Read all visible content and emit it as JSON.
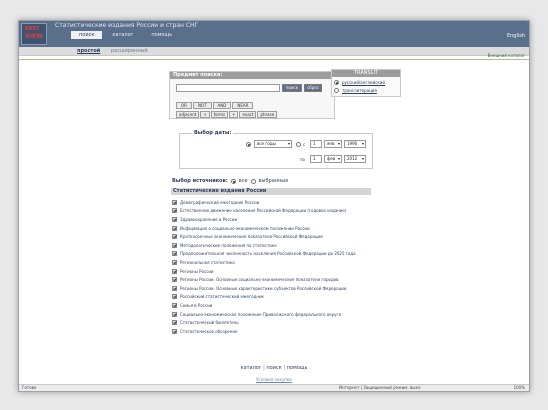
{
  "header": {
    "title": "Статистические издания России и стран СНГ",
    "lang_link": "English",
    "tabs": [
      {
        "label": "поиск"
      },
      {
        "label": "каталог"
      },
      {
        "label": "помощь"
      }
    ],
    "logo_line1": "EAST",
    "logo_line2": "VIEW"
  },
  "subnav": {
    "simple": "простой",
    "advanced": "расширенный"
  },
  "ext_link": "Внешний каталог",
  "search": {
    "title": "Предмет поиска:",
    "query_value": "",
    "search_btn": "поиск",
    "reset_btn": "сброс",
    "ops": [
      "OR",
      "NOT",
      "AND",
      "NEAR"
    ],
    "ops2": [
      "adjacent",
      "+",
      "forms",
      "+",
      "exact",
      "phrase"
    ]
  },
  "translit": {
    "title": "TRANSLIT",
    "opt1": "русский/английский",
    "opt2": "транслитерация"
  },
  "date": {
    "legend": "Выбор даты:",
    "range": "все годы",
    "from_label": "с",
    "to_label": "по",
    "from_day": "1",
    "from_month": "янв",
    "from_year": "1990",
    "to_day": "1",
    "to_month": "фев",
    "to_year": "2012"
  },
  "sources": {
    "label": "Выбор источников:",
    "all": "все",
    "selected": "выбранные"
  },
  "list": {
    "header": "Статистические издания России",
    "items": [
      "Демографический ежегодник России",
      "Естественное движение населения Российской Федерации (годовое издание)",
      "Здравоохранение в России",
      "Информация о социально-экономическом положении России",
      "Краткосрочные экономические показатели Российской Федерации",
      "Методологические положения по статистике",
      "Предположительная численность населения Российской Федерации до 2025 года",
      "Региональная статистика",
      "Регионы России",
      "Регионы России. Основные социально-экономические показатели городов",
      "Регионы России. Основные характеристики субъектов Российской Федерации",
      "Российский статистический ежегодник",
      "Семья в России",
      "Социально-экономическое положение Приволжского федерального округа",
      "Статистический бюллетень",
      "Статистическое обозрение"
    ]
  },
  "footer": {
    "catalog": "каталог",
    "search": "поиск",
    "help": "помощь",
    "sep": "|",
    "bottom": "Условия покупки"
  },
  "status": {
    "left": "Готово",
    "middle": "Интернет | Защищенный режим: выкл.",
    "right": "100%"
  }
}
